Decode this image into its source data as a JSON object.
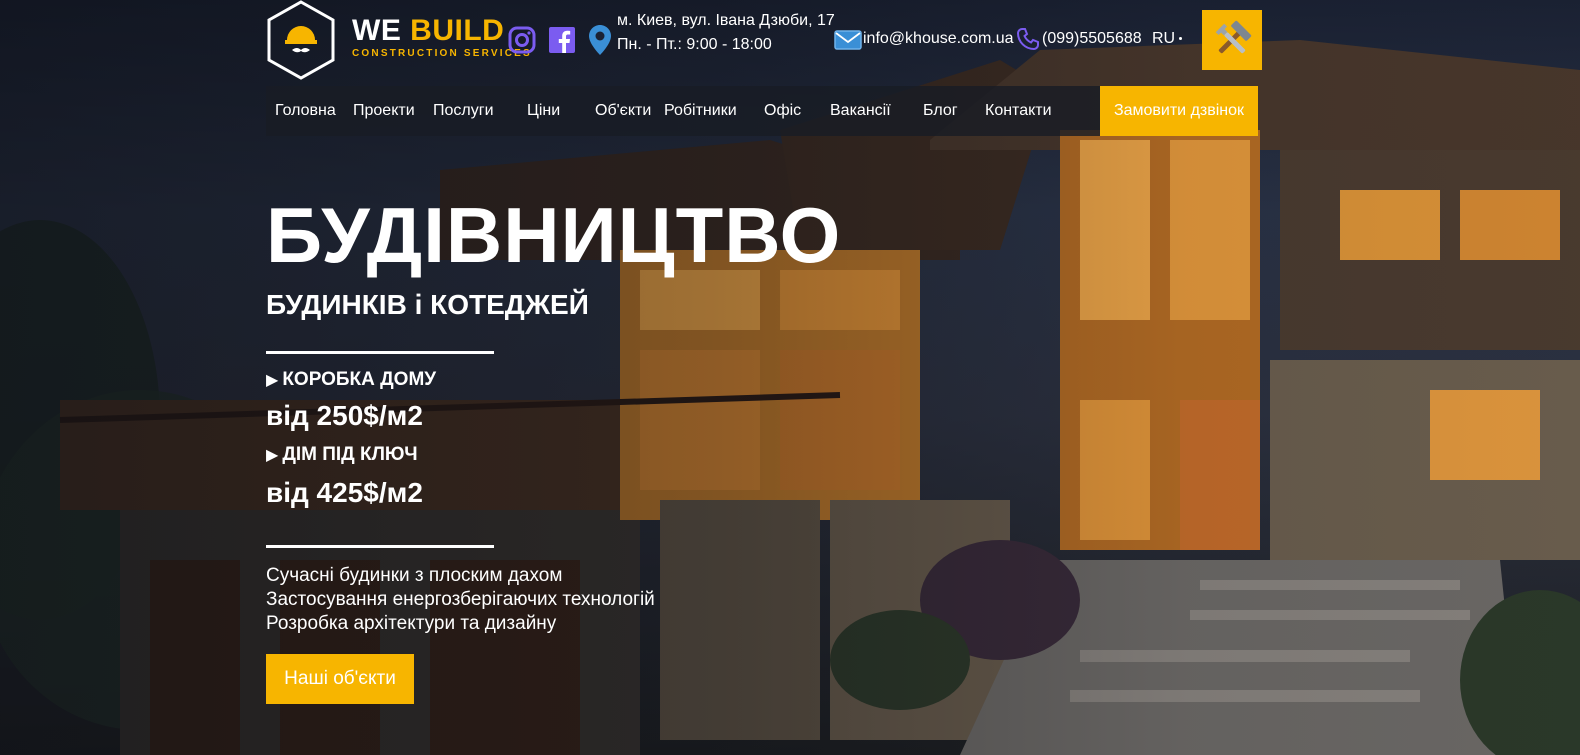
{
  "header": {
    "brand_title_a": "WE",
    "brand_title_b": "BUILD",
    "brand_subtitle": "CONSTRUCTION SERVICES",
    "address_line1": "м. Киев, вул. Івана Дзюби, 17",
    "address_line2": "Пн. - Пт.: 9:00 - 18:00",
    "email": "info@khouse.com.ua",
    "phone": "(099)5505688",
    "lang": "RU",
    "icons": [
      "instagram-icon",
      "facebook-icon",
      "location-pin-icon",
      "mail-icon",
      "phone-icon",
      "tools-icon"
    ]
  },
  "nav": {
    "items": [
      {
        "label": "Головна"
      },
      {
        "label": "Проекти"
      },
      {
        "label": "Послуги"
      },
      {
        "label": "Ціни"
      },
      {
        "label": "Об'єкти"
      },
      {
        "label": "Робітники"
      },
      {
        "label": "Офіс"
      },
      {
        "label": "Вакансії"
      },
      {
        "label": "Блог"
      },
      {
        "label": "Контакти"
      }
    ],
    "cta_label": "Замовити дзвінок"
  },
  "hero": {
    "title": "БУДІВНИЦТВО",
    "subtitle": "БУДИНКІВ і КОТЕДЖЕЙ",
    "prices": [
      {
        "label": "КОРОБКА ДОМУ",
        "value": "від 250$/м2"
      },
      {
        "label": "ДІМ ПІД КЛЮЧ",
        "value": "від 425$/м2"
      }
    ],
    "features": [
      "Сучасні будинки з плоским дахом",
      "Застосування енергозберігаючих технологій",
      "Розробка архітектури та дизайну"
    ],
    "cta_label": "Наші об'єкти"
  },
  "colors": {
    "accent": "#f7b500",
    "icon_purple": "#7b5cf0",
    "nav_bg": "#191c24"
  }
}
